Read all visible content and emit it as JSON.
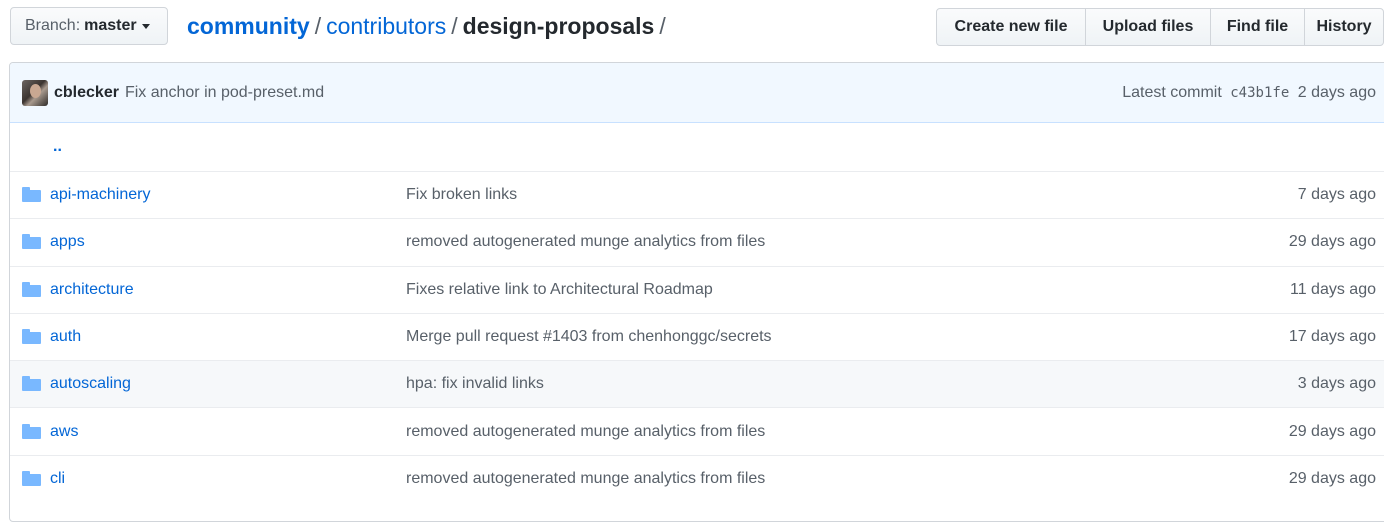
{
  "branch": {
    "label": "Branch:",
    "value": "master"
  },
  "breadcrumb": {
    "repo": "community",
    "sep1": "/",
    "dir": "contributors",
    "sep2": "/",
    "current": "design-proposals",
    "sep3": "/"
  },
  "actions": [
    {
      "label": "Create new file",
      "width": 150
    },
    {
      "label": "Upload files",
      "width": 126
    },
    {
      "label": "Find file",
      "width": 95
    },
    {
      "label": "History",
      "width": 80
    }
  ],
  "commit": {
    "author": "cblecker",
    "message": "Fix anchor in pod-preset.md",
    "latest_label": "Latest commit",
    "sha": "c43b1fe",
    "age": "2 days ago"
  },
  "up_link": "..",
  "files": [
    {
      "name": "api-machinery",
      "message": "Fix broken links",
      "age": "7 days ago"
    },
    {
      "name": "apps",
      "message": "removed autogenerated munge analytics from files",
      "age": "29 days ago"
    },
    {
      "name": "architecture",
      "message": "Fixes relative link to Architectural Roadmap",
      "age": "11 days ago"
    },
    {
      "name": "auth",
      "message": "Merge pull request #1403 from chenhonggc/secrets",
      "age": "17 days ago"
    },
    {
      "name": "autoscaling",
      "message": "hpa: fix invalid links",
      "age": "3 days ago"
    },
    {
      "name": "aws",
      "message": "removed autogenerated munge analytics from files",
      "age": "29 days ago"
    },
    {
      "name": "cli",
      "message": "removed autogenerated munge analytics from files",
      "age": "29 days ago"
    }
  ],
  "colors": {
    "link": "#0366d6",
    "muted": "#586069",
    "commit_bg": "#f1f8ff",
    "folder": "#79b8ff"
  }
}
